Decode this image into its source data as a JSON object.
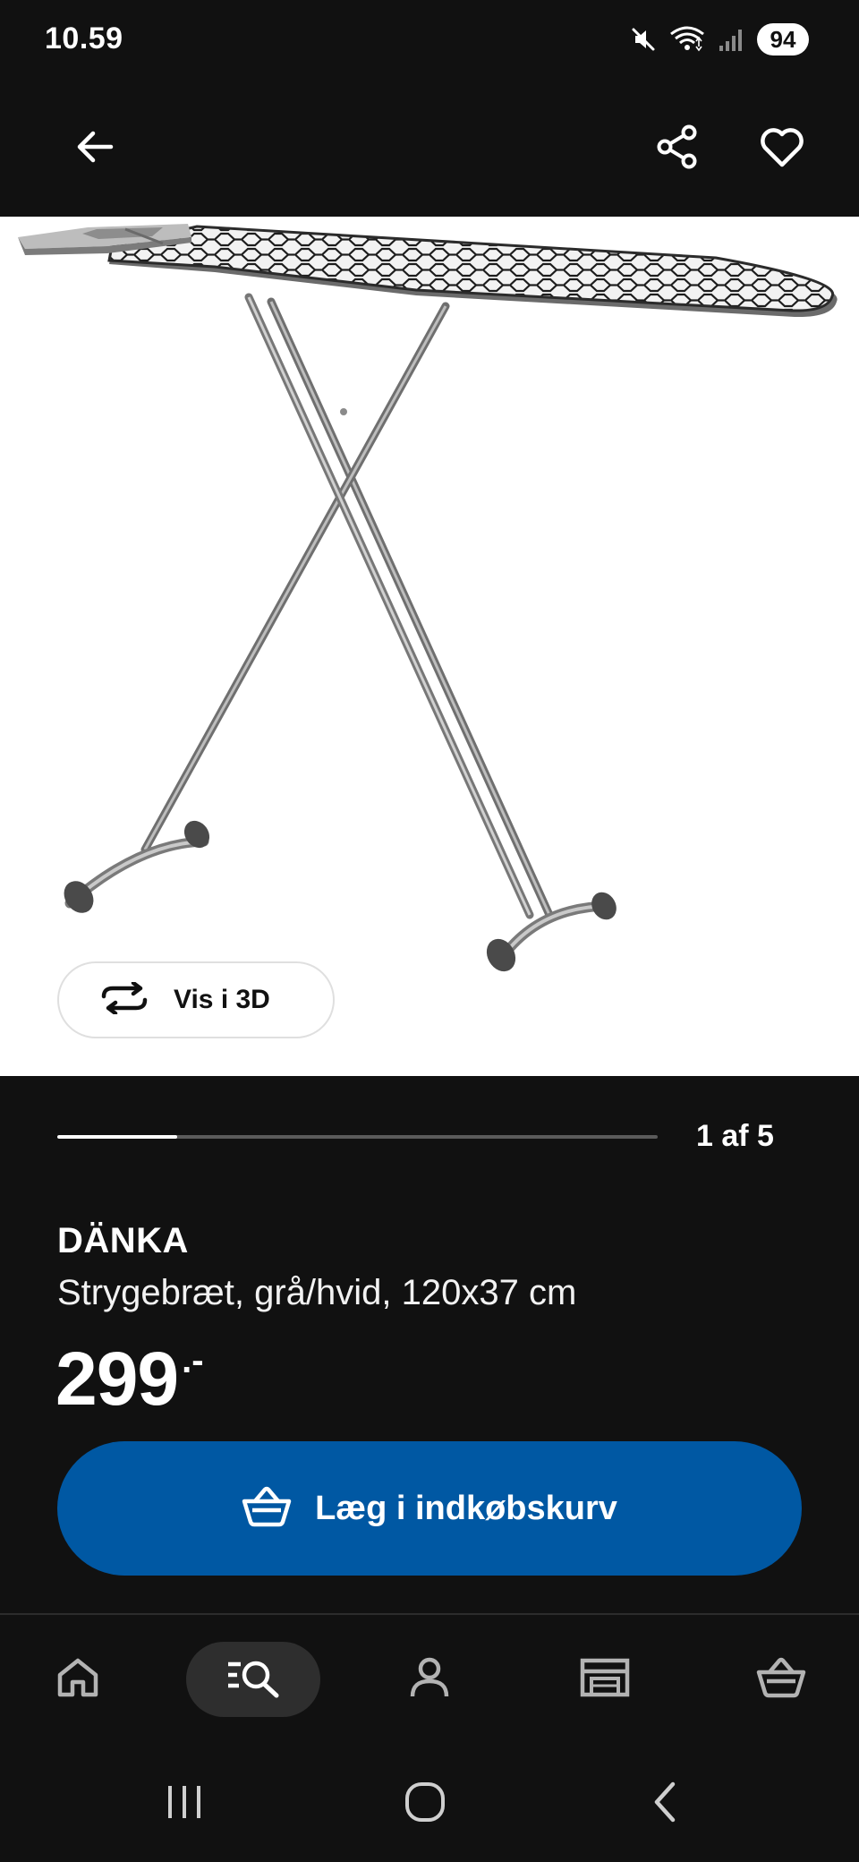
{
  "status_bar": {
    "time": "10.59",
    "battery_level": "94",
    "icons": [
      "mute-icon",
      "wifi-icon",
      "signal-icon",
      "battery-icon"
    ]
  },
  "header": {
    "icons": [
      "back-arrow-icon",
      "share-icon",
      "heart-icon"
    ]
  },
  "product_image": {
    "view_3d_label": "Vis i 3D",
    "view_3d_icon": "rotate-3d-icon"
  },
  "carousel": {
    "counter": "1 af 5",
    "current": 1,
    "total": 5
  },
  "product": {
    "name": "DÄNKA",
    "description": "Strygebræt, grå/hvid, 120x37 cm",
    "price": "299",
    "price_suffix": ".-"
  },
  "add_to_cart": {
    "label": "Læg i indkøbskurv",
    "icon": "basket-icon"
  },
  "bottom_nav": {
    "items": [
      {
        "name": "home",
        "icon": "home-icon",
        "active": false
      },
      {
        "name": "browse",
        "icon": "search-browse-icon",
        "active": true
      },
      {
        "name": "profile",
        "icon": "user-icon",
        "active": false
      },
      {
        "name": "stores",
        "icon": "store-icon",
        "active": false
      },
      {
        "name": "cart",
        "icon": "basket-icon",
        "active": false
      }
    ]
  },
  "system_nav": {
    "icons": [
      "recents-icon",
      "home-circle-icon",
      "back-chevron-icon"
    ]
  },
  "colors": {
    "background": "#111111",
    "accent_blue": "#0058a3",
    "image_background": "#ffffff",
    "active_nav_bg": "#2e2e2e"
  }
}
